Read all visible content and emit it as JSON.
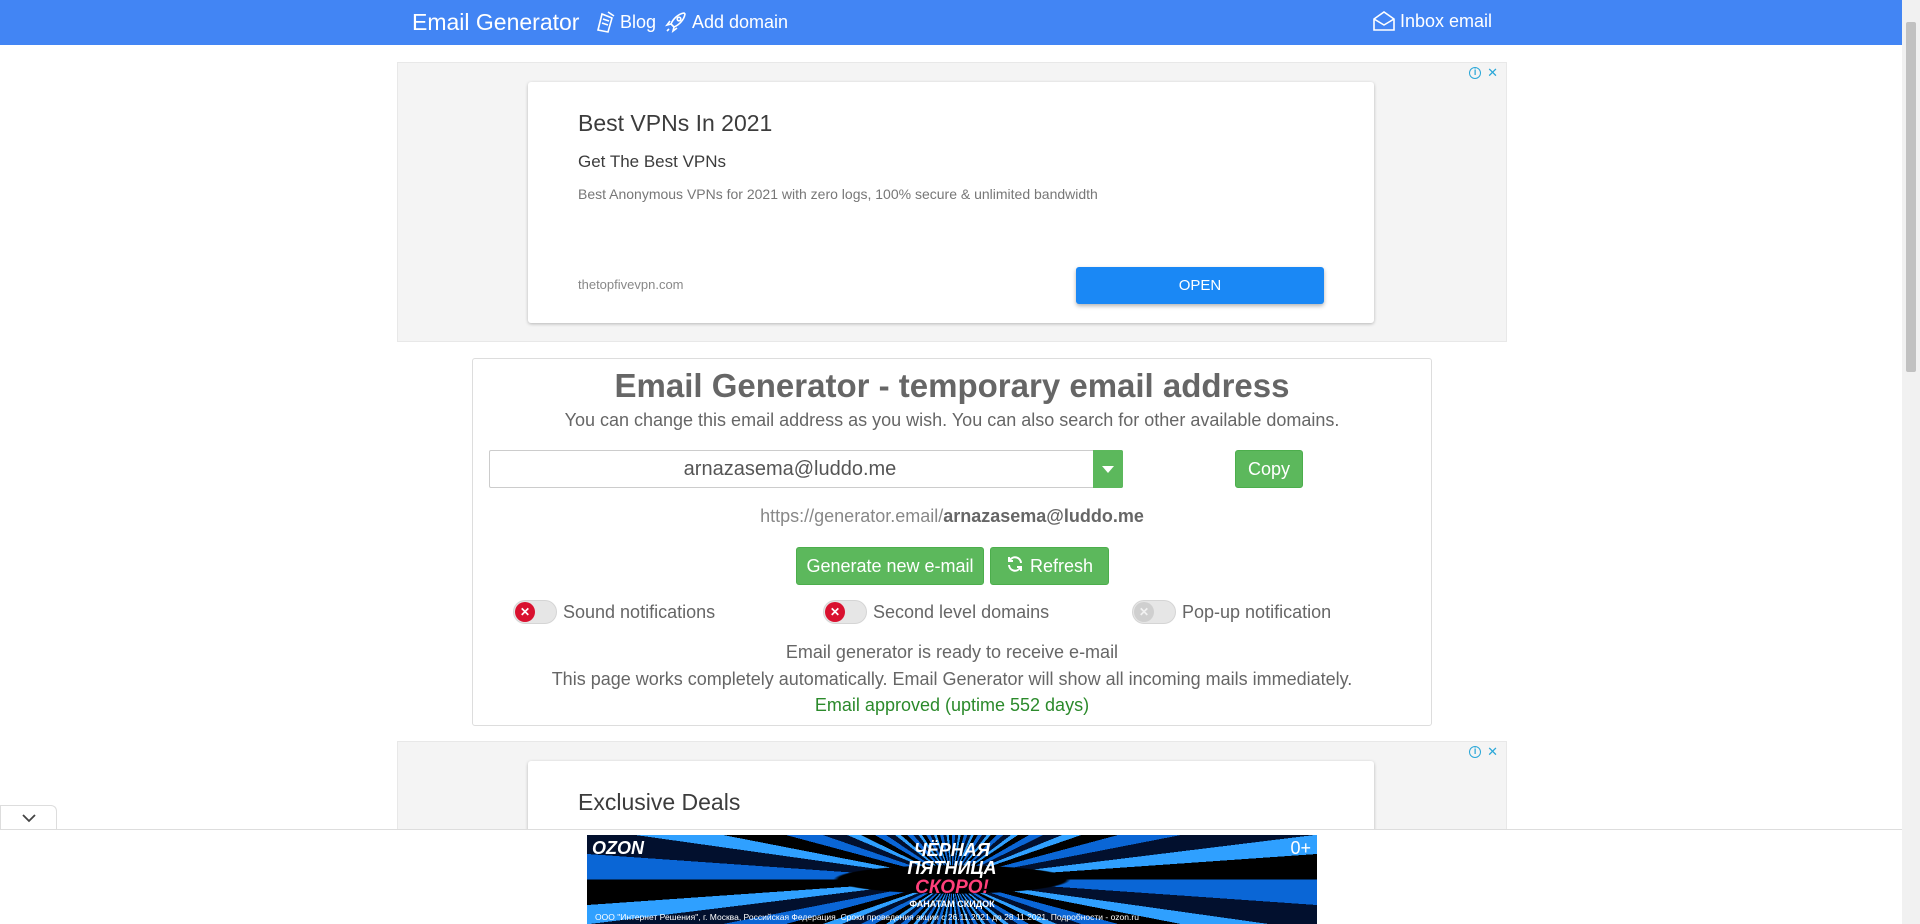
{
  "navbar": {
    "brand": "Email Generator",
    "blog": "Blog",
    "add_domain": "Add domain",
    "inbox": "Inbox email",
    "bg_color": "#4285f4"
  },
  "ad_top": {
    "title": "Best VPNs In 2021",
    "subtitle": "Get The Best VPNs",
    "description": "Best Anonymous VPNs for 2021 with zero logs, 100% secure & unlimited bandwidth",
    "domain": "thetopfivevpn.com",
    "open_label": "OPEN"
  },
  "main": {
    "title": "Email Generator - temporary email address",
    "subtitle": "You can change this email address as you wish. You can also search for other available domains.",
    "email_value": "arnazasema@luddo.me",
    "copy_label": "Copy",
    "url_prefix": "https://generator.email/",
    "url_email": "arnazasema@luddo.me",
    "generate_label": "Generate new e-mail",
    "refresh_label": "Refresh",
    "toggles": [
      {
        "label": "Sound notifications",
        "state": "off"
      },
      {
        "label": "Second level domains",
        "state": "off"
      },
      {
        "label": "Pop-up notification",
        "state": "disabled"
      }
    ],
    "status_ready": "Email generator is ready to receive e-mail",
    "status_auto": "This page works completely automatically. Email Generator will show all incoming mails immediately.",
    "status_approved": "Email approved (uptime 552 days)",
    "accent_color": "#5cb85c"
  },
  "ad_bottom": {
    "title": "Exclusive Deals"
  },
  "ozon_banner": {
    "logo": "OZON",
    "age": "0+",
    "headline_1": "ЧЁРНАЯ",
    "headline_2": "ПЯТНИЦА",
    "soon": "СКОРО!",
    "fans": "ФАНАТАМ СКИДОК",
    "legal": "ООО \"Интернет Решения\", г. Москва, Российская Федерация. Сроки проведения акции с 26.11.2021 до 28.11.2021. Подробности - ozon.ru"
  }
}
